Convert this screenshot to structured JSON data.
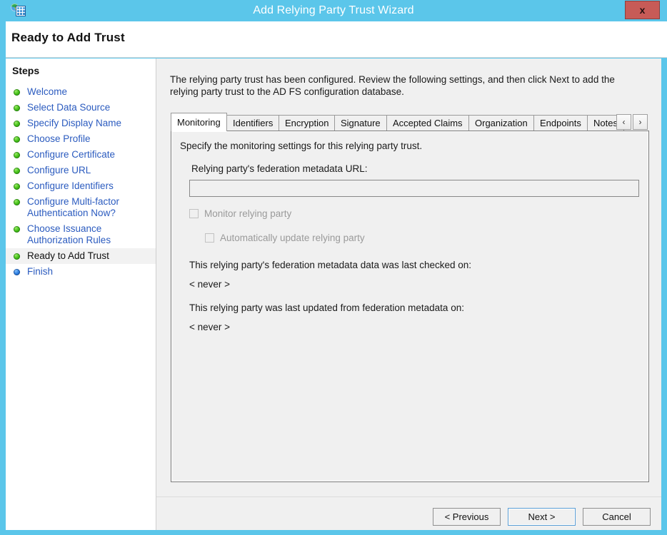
{
  "window": {
    "title": "Add Relying Party Trust Wizard",
    "icon": "adfs-wizard-icon",
    "close_label": "x",
    "accent_color": "#5bc6ea",
    "titlebar_text_color": "#ffffff",
    "close_button_color": "#c75b57"
  },
  "header": {
    "title": "Ready to Add Trust"
  },
  "sidebar": {
    "heading": "Steps",
    "items": [
      {
        "label": "Welcome",
        "state": "done",
        "bullet": "green"
      },
      {
        "label": "Select Data Source",
        "state": "done",
        "bullet": "green"
      },
      {
        "label": "Specify Display Name",
        "state": "done",
        "bullet": "green"
      },
      {
        "label": "Choose Profile",
        "state": "done",
        "bullet": "green"
      },
      {
        "label": "Configure Certificate",
        "state": "done",
        "bullet": "green"
      },
      {
        "label": "Configure URL",
        "state": "done",
        "bullet": "green"
      },
      {
        "label": "Configure Identifiers",
        "state": "done",
        "bullet": "green"
      },
      {
        "label": "Configure Multi-factor Authentication Now?",
        "state": "done",
        "bullet": "green"
      },
      {
        "label": "Choose Issuance Authorization Rules",
        "state": "done",
        "bullet": "green"
      },
      {
        "label": "Ready to Add Trust",
        "state": "current",
        "bullet": "green"
      },
      {
        "label": "Finish",
        "state": "pending",
        "bullet": "blue"
      }
    ]
  },
  "main": {
    "intro": "The relying party trust has been configured. Review the following settings, and then click Next to add the relying party trust to the AD FS configuration database.",
    "tabs": [
      {
        "label": "Monitoring",
        "selected": true
      },
      {
        "label": "Identifiers",
        "selected": false
      },
      {
        "label": "Encryption",
        "selected": false
      },
      {
        "label": "Signature",
        "selected": false
      },
      {
        "label": "Accepted Claims",
        "selected": false
      },
      {
        "label": "Organization",
        "selected": false
      },
      {
        "label": "Endpoints",
        "selected": false
      },
      {
        "label": "Notes",
        "selected": false
      }
    ],
    "tab_scroll_left": "‹",
    "tab_scroll_right": "›",
    "monitoring": {
      "heading": "Specify the monitoring settings for this relying party trust.",
      "url_label": "Relying party's federation metadata URL:",
      "url_value": "",
      "url_placeholder": "",
      "checkbox_monitor": {
        "label": "Monitor relying party",
        "checked": false,
        "disabled": true
      },
      "checkbox_autoupdate": {
        "label": "Automatically update relying party",
        "checked": false,
        "disabled": true
      },
      "last_checked_label": "This relying party's federation metadata data was last checked on:",
      "last_checked_value": "< never >",
      "last_updated_label": "This relying party was last updated from federation metadata on:",
      "last_updated_value": "< never >"
    }
  },
  "footer": {
    "previous_label": "< Previous",
    "next_label": "Next >",
    "cancel_label": "Cancel",
    "default_button": "Next >"
  }
}
